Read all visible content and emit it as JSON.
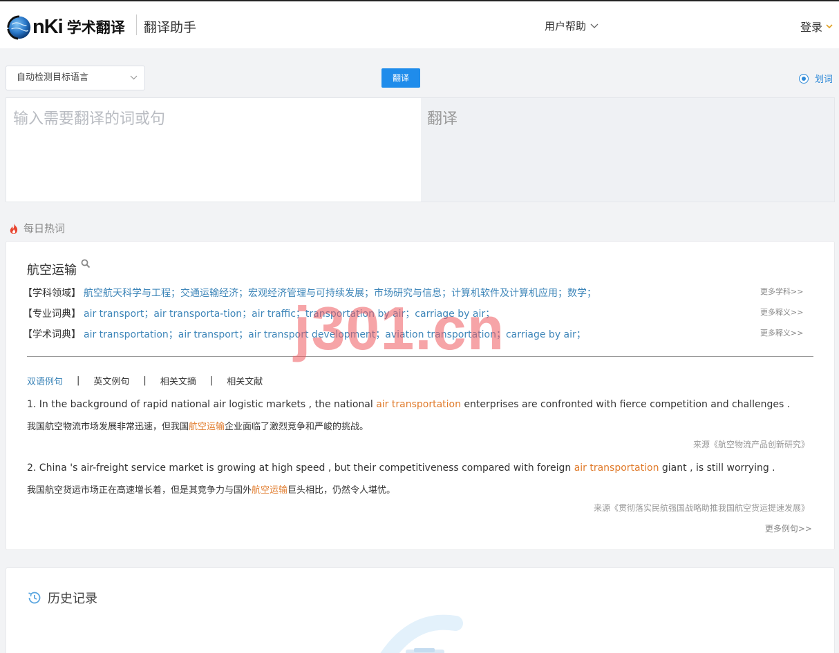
{
  "header": {
    "brand_logo": "nKi",
    "brand_name": "学术翻译",
    "app_title": "翻译助手",
    "help_menu": "用户帮助",
    "login": "登录"
  },
  "toolbar": {
    "language_select": "自动检测目标语言",
    "translate_button": "翻译",
    "word_pick_label": "划词"
  },
  "editor": {
    "input_placeholder": "输入需要翻译的词或句",
    "output_placeholder": "翻译"
  },
  "hot_words": {
    "title": "每日热词",
    "term": "航空运输",
    "definitions": [
      {
        "label": "【学科领域】",
        "values": "航空航天科学与工程；交通运输经济；宏观经济管理与可持续发展；市场研究与信息；计算机软件及计算机应用；数学；",
        "more": "更多学科>>"
      },
      {
        "label": "【专业词典】",
        "values": "air transport；air transporta-tion；air traffic；transportation by air；carriage by air；",
        "more": "更多释义>>"
      },
      {
        "label": "【学术词典】",
        "values": "air transportation；air transport；air transport development；aviation transportation；carriage by air；",
        "more": "更多释义>>"
      }
    ],
    "tabs": [
      "双语例句",
      "英文例句",
      "相关文摘",
      "相关文献"
    ],
    "examples": [
      {
        "en_before": "1. In the background of rapid national air logistic markets , the national ",
        "en_highlight": "air transportation",
        "en_after": " enterprises are confronted with fierce competition and challenges .",
        "cn_before": "我国航空物流市场发展非常迅速，但我国",
        "cn_highlight": "航空运输",
        "cn_after": "企业面临了激烈竞争和严峻的挑战。",
        "source": "来源《航空物流产品创新研究》"
      },
      {
        "en_before": "2. China 's air-freight service market is growing at high speed , but their competitiveness compared with foreign ",
        "en_highlight": "air transportation",
        "en_after": " giant , is still worrying .",
        "cn_before": "我国航空货运市场正在高速增长着，但是其竞争力与国外",
        "cn_highlight": "航空运输",
        "cn_after": "巨头相比，仍然令人堪忧。",
        "source": "来源《贯彻落实民航强国战略助推我国航空货运提速发展》"
      }
    ],
    "more_examples": "更多例句>>"
  },
  "history": {
    "title": "历史记录"
  },
  "watermark": "j301.cn",
  "colors": {
    "accent": "#1f8ceb",
    "link": "#3e86b9",
    "highlight": "#e07a2a",
    "watermark": "#ee5a5f"
  }
}
